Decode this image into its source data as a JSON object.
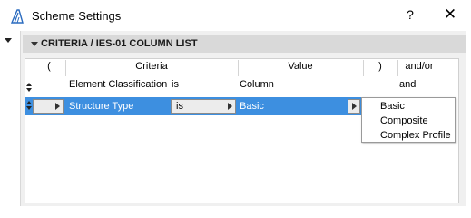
{
  "window": {
    "title": "Scheme Settings",
    "help_label": "?",
    "close_label": "✕"
  },
  "section": {
    "title": "CRITERIA / IES-01 COLUMN LIST"
  },
  "table": {
    "columns": [
      "(",
      "Criteria",
      "Value",
      ")",
      "and/or"
    ],
    "rows": [
      {
        "criteria": "Element Classification",
        "operator": "is",
        "value": "Column",
        "andor": "and"
      },
      {
        "criteria": "Structure Type",
        "operator": "is",
        "value": "Basic",
        "andor": ""
      }
    ]
  },
  "value_dropdown": {
    "options": [
      "Basic",
      "Composite",
      "Complex Profile"
    ]
  },
  "colors": {
    "selection": "#3d8fe0",
    "section_header": "#d9d9d9",
    "panel": "#f0f0f0"
  }
}
